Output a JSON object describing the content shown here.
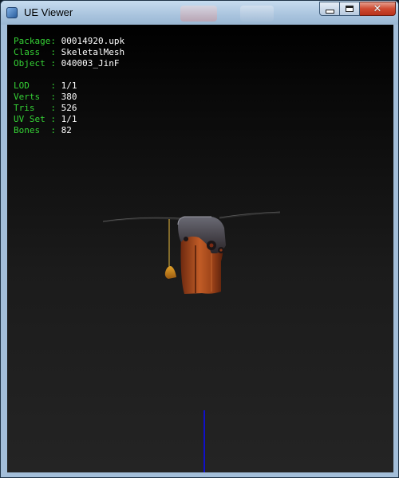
{
  "window": {
    "title": "UE Viewer",
    "controls": {
      "minimize": "minimize",
      "maximize": "maximize",
      "close": "close"
    }
  },
  "info": {
    "package": {
      "key": "Package:",
      "value": "00014920.upk"
    },
    "class": {
      "key": "Class  :",
      "value": "SkeletalMesh"
    },
    "object": {
      "key": "Object :",
      "value": "040003_JinF"
    },
    "lod": {
      "key": "LOD    :",
      "value": "1/1"
    },
    "verts": {
      "key": "Verts  :",
      "value": "380"
    },
    "tris": {
      "key": "Tris   :",
      "value": "526"
    },
    "uvset": {
      "key": "UV Set :",
      "value": "1/1"
    },
    "bones": {
      "key": "Bones  :",
      "value": "82"
    }
  },
  "colors": {
    "label_green": "#35d235",
    "value_white": "#ffffff",
    "axis_blue": "#1010c8",
    "mesh_orange": "#b5541f"
  },
  "icons": {
    "app": "ue-viewer-app-icon",
    "close": "close-icon",
    "minimize": "minimize-icon",
    "maximize": "maximize-icon"
  }
}
